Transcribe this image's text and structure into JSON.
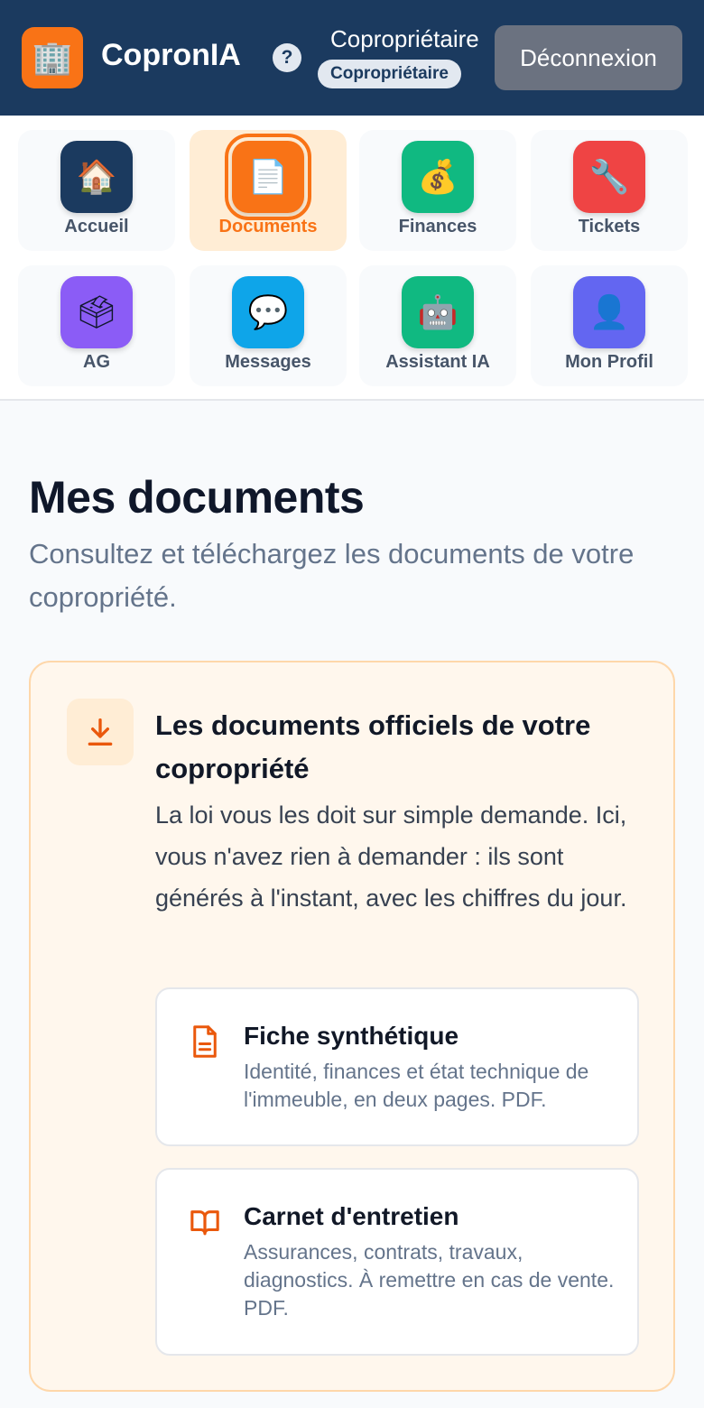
{
  "header": {
    "logo_icon": "🏢",
    "brand": "CopronIA",
    "help_label": "?",
    "user_name": "Copropriétaire",
    "role_badge": "Copropriétaire",
    "logout_label": "Déconnexion",
    "background_color": "#1b3a5f"
  },
  "nav": {
    "items": [
      {
        "id": "accueil",
        "label": "Accueil",
        "icon": "🏠",
        "icon_name": "house-icon",
        "color": "#1b3a5f",
        "active": false
      },
      {
        "id": "documents",
        "label": "Documents",
        "icon": "📄",
        "icon_name": "document-icon",
        "color": "#f97316",
        "active": true
      },
      {
        "id": "finances",
        "label": "Finances",
        "icon": "💰",
        "icon_name": "money-bag-icon",
        "color": "#10b981",
        "active": false
      },
      {
        "id": "tickets",
        "label": "Tickets",
        "icon": "🔧",
        "icon_name": "wrench-icon",
        "color": "#ef4444",
        "active": false
      },
      {
        "id": "ag",
        "label": "AG",
        "icon": "🗳",
        "icon_name": "ballot-box-icon",
        "color": "#8b5cf6",
        "active": false
      },
      {
        "id": "messages",
        "label": "Messages",
        "icon": "💬",
        "icon_name": "speech-bubble-icon",
        "color": "#0ea5e9",
        "active": false
      },
      {
        "id": "assistant",
        "label": "Assistant IA",
        "icon": "🤖",
        "icon_name": "robot-icon",
        "color": "#10b981",
        "active": false
      },
      {
        "id": "profil",
        "label": "Mon Profil",
        "icon": "👤",
        "icon_name": "user-icon",
        "color": "#6366f1",
        "active": false
      }
    ]
  },
  "main": {
    "title": "Mes documents",
    "subtitle": "Consultez et téléchargez les documents de votre copropriété."
  },
  "official_docs": {
    "icon": "download-icon",
    "title": "Les documents officiels de votre copropriété",
    "description": "La loi vous les doit sur simple demande. Ici, vous n'avez rien à demander : ils sont générés à l'instant, avec les chiffres du jour.",
    "documents": [
      {
        "title": "Fiche synthétique",
        "description": "Identité, finances et état technique de l'immeuble, en deux pages. PDF.",
        "icon": "file-text-icon"
      },
      {
        "title": "Carnet d'entretien",
        "description": "Assurances, contrats, travaux, diagnostics. À remettre en cas de vente. PDF.",
        "icon": "open-book-icon"
      }
    ],
    "accent_color": "#f97316"
  }
}
